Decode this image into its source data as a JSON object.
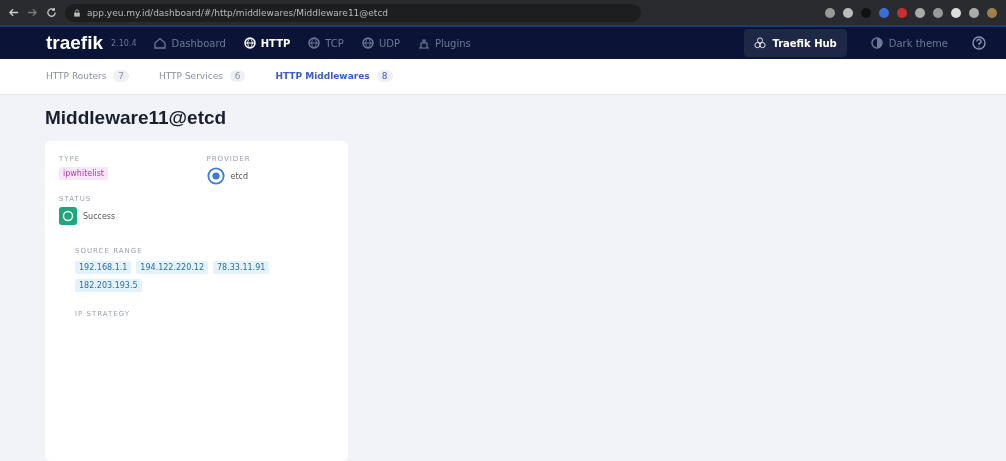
{
  "browser": {
    "url": "app.yeu.my.id/dashboard/#/http/middlewares/Middleware11@etcd"
  },
  "navbar": {
    "logo": "traefik",
    "version": "2.10.4",
    "items": [
      {
        "label": "Dashboard",
        "selected": false
      },
      {
        "label": "HTTP",
        "selected": true
      },
      {
        "label": "TCP",
        "selected": false
      },
      {
        "label": "UDP",
        "selected": false
      },
      {
        "label": "Plugins",
        "selected": false
      }
    ],
    "hub": "Traefik Hub",
    "theme": "Dark theme"
  },
  "subtabs": [
    {
      "label": "HTTP Routers",
      "count": "7",
      "selected": false
    },
    {
      "label": "HTTP Services",
      "count": "6",
      "selected": false
    },
    {
      "label": "HTTP Middlewares",
      "count": "8",
      "selected": true
    }
  ],
  "title": "Middleware11@etcd",
  "card": {
    "type_label": "TYPE",
    "type": "ipwhitelist",
    "provider_label": "PROVIDER",
    "provider": "etcd",
    "status_label": "STATUS",
    "status": "Success",
    "source_range_label": "SOURCE RANGE",
    "source_range": [
      "192.168.1.1",
      "194.122.220.12",
      "78.33.11.91",
      "182.203.193.5"
    ],
    "ip_strategy_label": "IP STRATEGY"
  }
}
